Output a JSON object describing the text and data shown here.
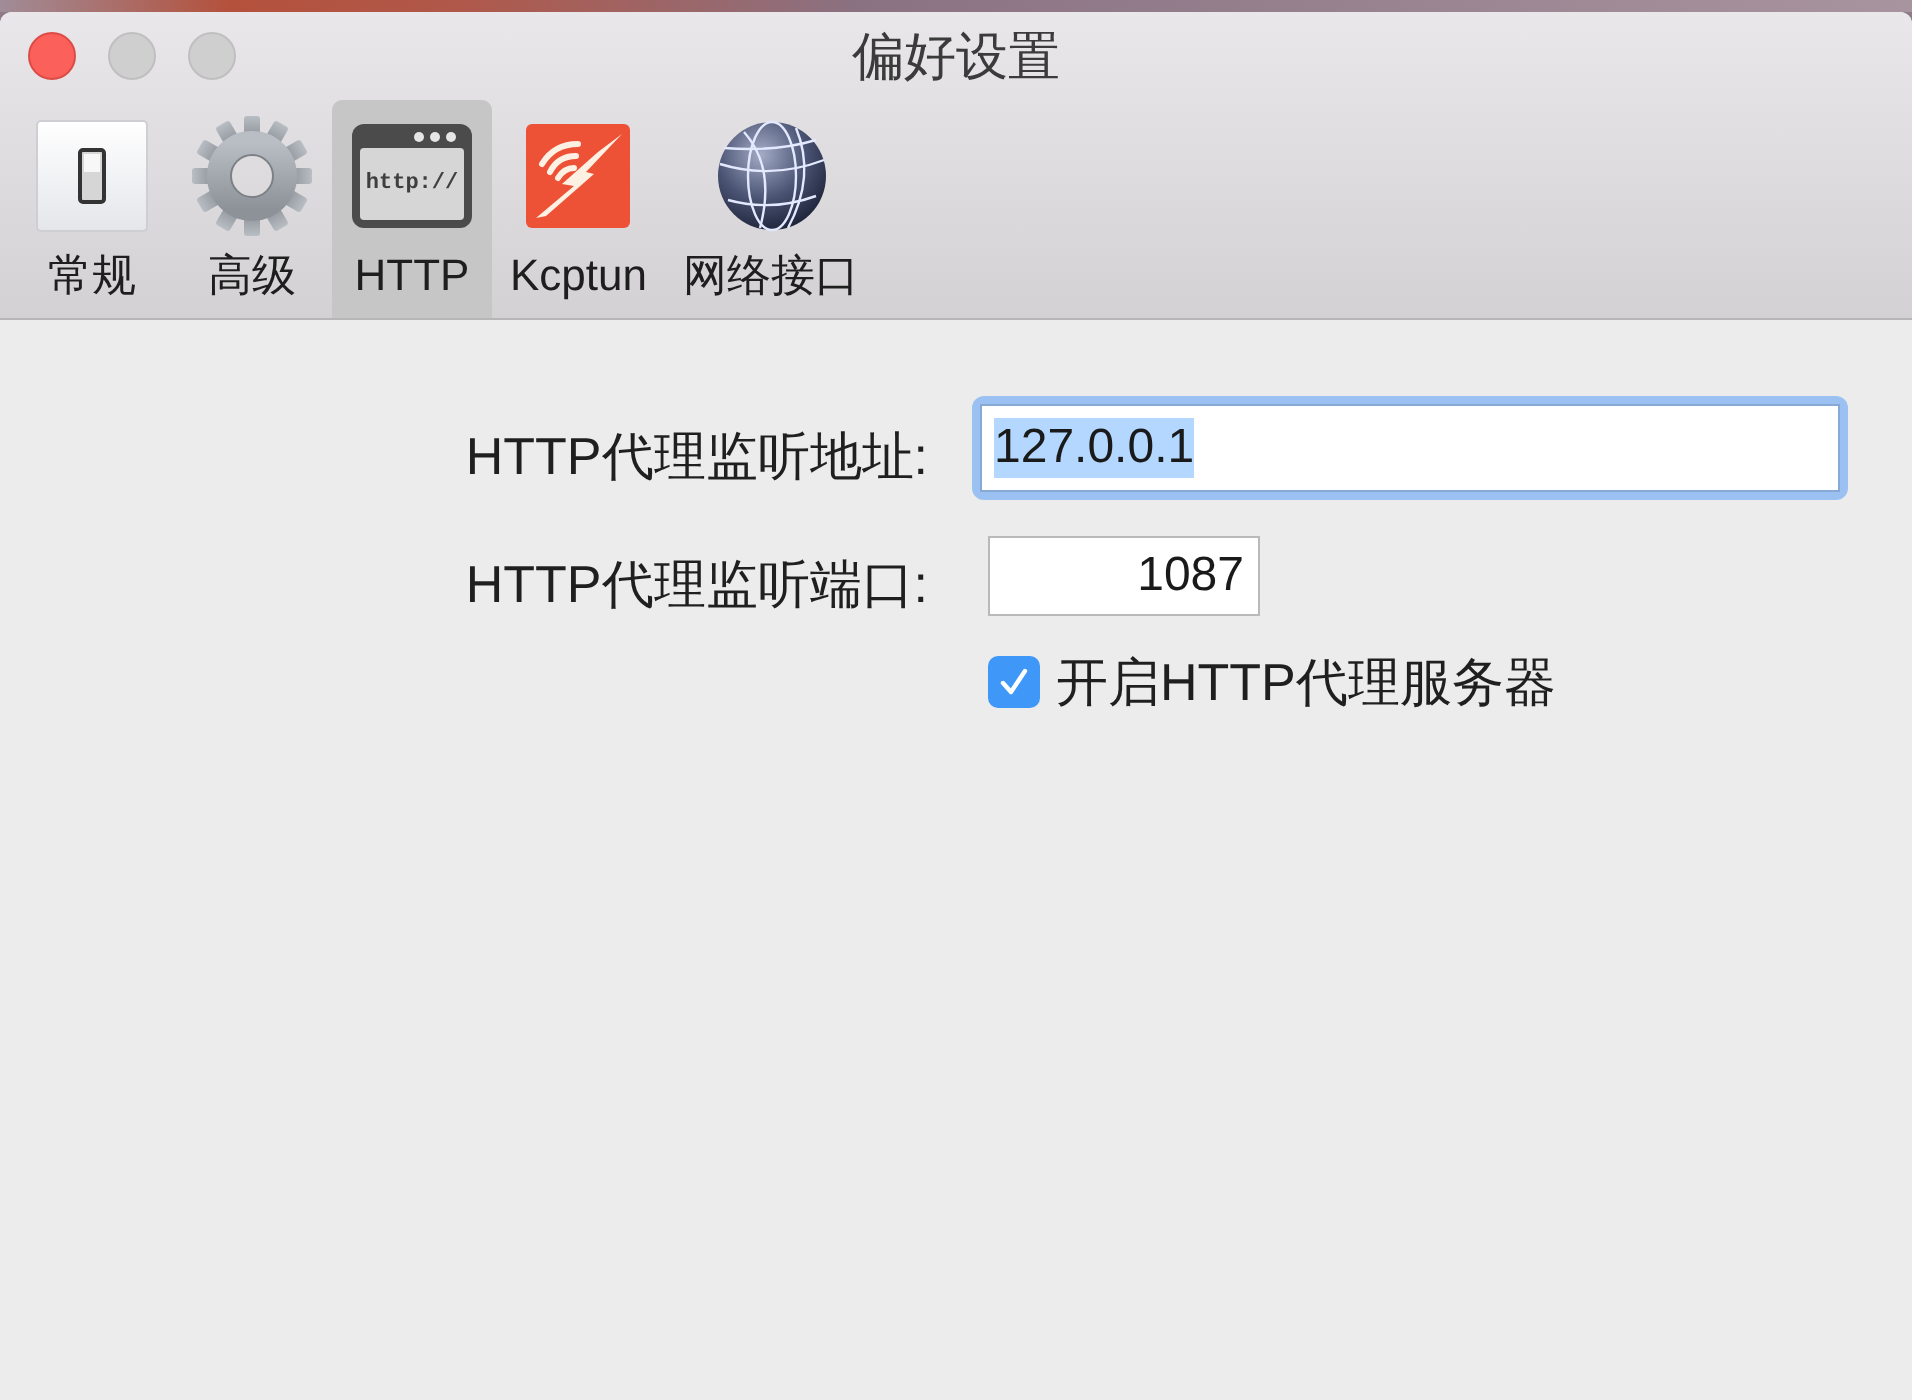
{
  "window": {
    "title": "偏好设置",
    "buttons": [
      {
        "kind": "close",
        "disabled": false
      },
      {
        "kind": "minimize",
        "disabled": true
      },
      {
        "kind": "zoom",
        "disabled": true
      }
    ]
  },
  "toolbar": {
    "tabs": [
      {
        "label": "常规",
        "kind": "switch",
        "selected": false
      },
      {
        "label": "高级",
        "kind": "gear",
        "selected": false
      },
      {
        "label": "HTTP",
        "kind": "browser",
        "icon_text": "http://",
        "selected": true
      },
      {
        "label": "Kcptun",
        "kind": "bolt",
        "selected": false
      },
      {
        "label": "网络接口",
        "kind": "globe",
        "selected": false
      }
    ]
  },
  "form": {
    "fields": [
      {
        "label": "HTTP代理监听地址:",
        "kind": "text",
        "value": "127.0.0.1",
        "focused": true,
        "text_selected": true
      },
      {
        "label": "HTTP代理监听端口:",
        "kind": "number",
        "value": "1087",
        "focused": false,
        "text_selected": false
      }
    ],
    "checkbox": {
      "label": "开启HTTP代理服务器",
      "checked": true
    }
  }
}
